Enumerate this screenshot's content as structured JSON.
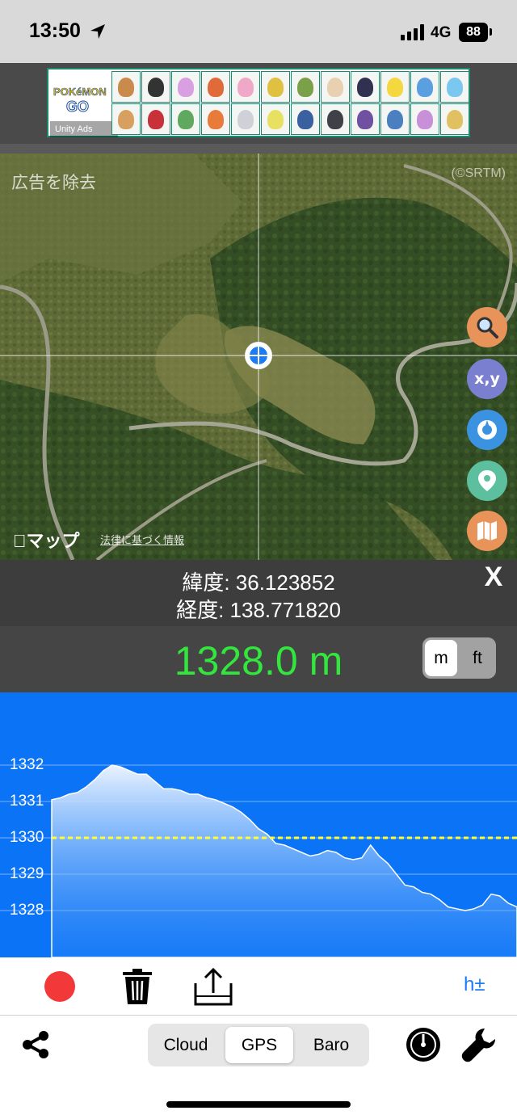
{
  "status_bar": {
    "time": "13:50",
    "network": "4G",
    "battery": "88"
  },
  "ad": {
    "brand": "POKéMON",
    "brand_sub": "GO",
    "provider": "Unity Ads"
  },
  "map": {
    "remove_ads_label": "広告を除去",
    "terrain_credit": "(©SRTM)",
    "maps_logo": "マップ",
    "legal_link": "法律に基づく情報",
    "buttons": {
      "search_icon": "magnifier-icon",
      "xy_label": "x,y",
      "compass_icon": "compass-icon",
      "pin_icon": "location-pin-icon",
      "map_icon": "folded-map-icon"
    },
    "colors": {
      "search_btn": "#e8935a",
      "xy_btn": "#7b7fd0",
      "compass_btn": "#3a92e0",
      "pin_btn": "#5cbf9e",
      "map_btn": "#e8935a"
    }
  },
  "coordinates": {
    "latitude_label": "緯度:",
    "latitude": "36.123852",
    "longitude_label": "経度:",
    "longitude": "138.771820",
    "close_label": "X"
  },
  "altitude": {
    "value": "1328.0 m",
    "value_color": "#33e63d",
    "units": [
      "m",
      "ft"
    ],
    "selected_unit": "m"
  },
  "chart_data": {
    "type": "area",
    "y_ticks": [
      "1332",
      "1331",
      "1330",
      "1329",
      "1328"
    ],
    "ylim": [
      1327.5,
      1332.3
    ],
    "reference_line": 1330,
    "reference_color": "#ffff33",
    "values": [
      1331.05,
      1331.1,
      1331.2,
      1331.25,
      1331.4,
      1331.6,
      1331.85,
      1332.0,
      1331.95,
      1331.85,
      1331.75,
      1331.75,
      1331.55,
      1331.35,
      1331.35,
      1331.3,
      1331.2,
      1331.2,
      1331.1,
      1331.05,
      1330.95,
      1330.85,
      1330.7,
      1330.5,
      1330.25,
      1330.1,
      1329.85,
      1329.8,
      1329.7,
      1329.6,
      1329.5,
      1329.55,
      1329.65,
      1329.6,
      1329.45,
      1329.4,
      1329.45,
      1329.8,
      1329.5,
      1329.3,
      1329.0,
      1328.7,
      1328.65,
      1328.5,
      1328.45,
      1328.3,
      1328.1,
      1328.05,
      1328.0,
      1328.05,
      1328.15,
      1328.45,
      1328.4,
      1328.2,
      1328.1
    ]
  },
  "toolbar": {
    "record_color": "#f23838",
    "trash_icon": "trash-icon",
    "share_icon": "export-icon",
    "h_adjust_label": "h±"
  },
  "bottom_bar": {
    "share_icon": "share-icon",
    "modes": [
      "Cloud",
      "GPS",
      "Baro"
    ],
    "selected_mode": "GPS",
    "gauge_icon": "gauge-icon",
    "settings_icon": "wrench-icon"
  }
}
